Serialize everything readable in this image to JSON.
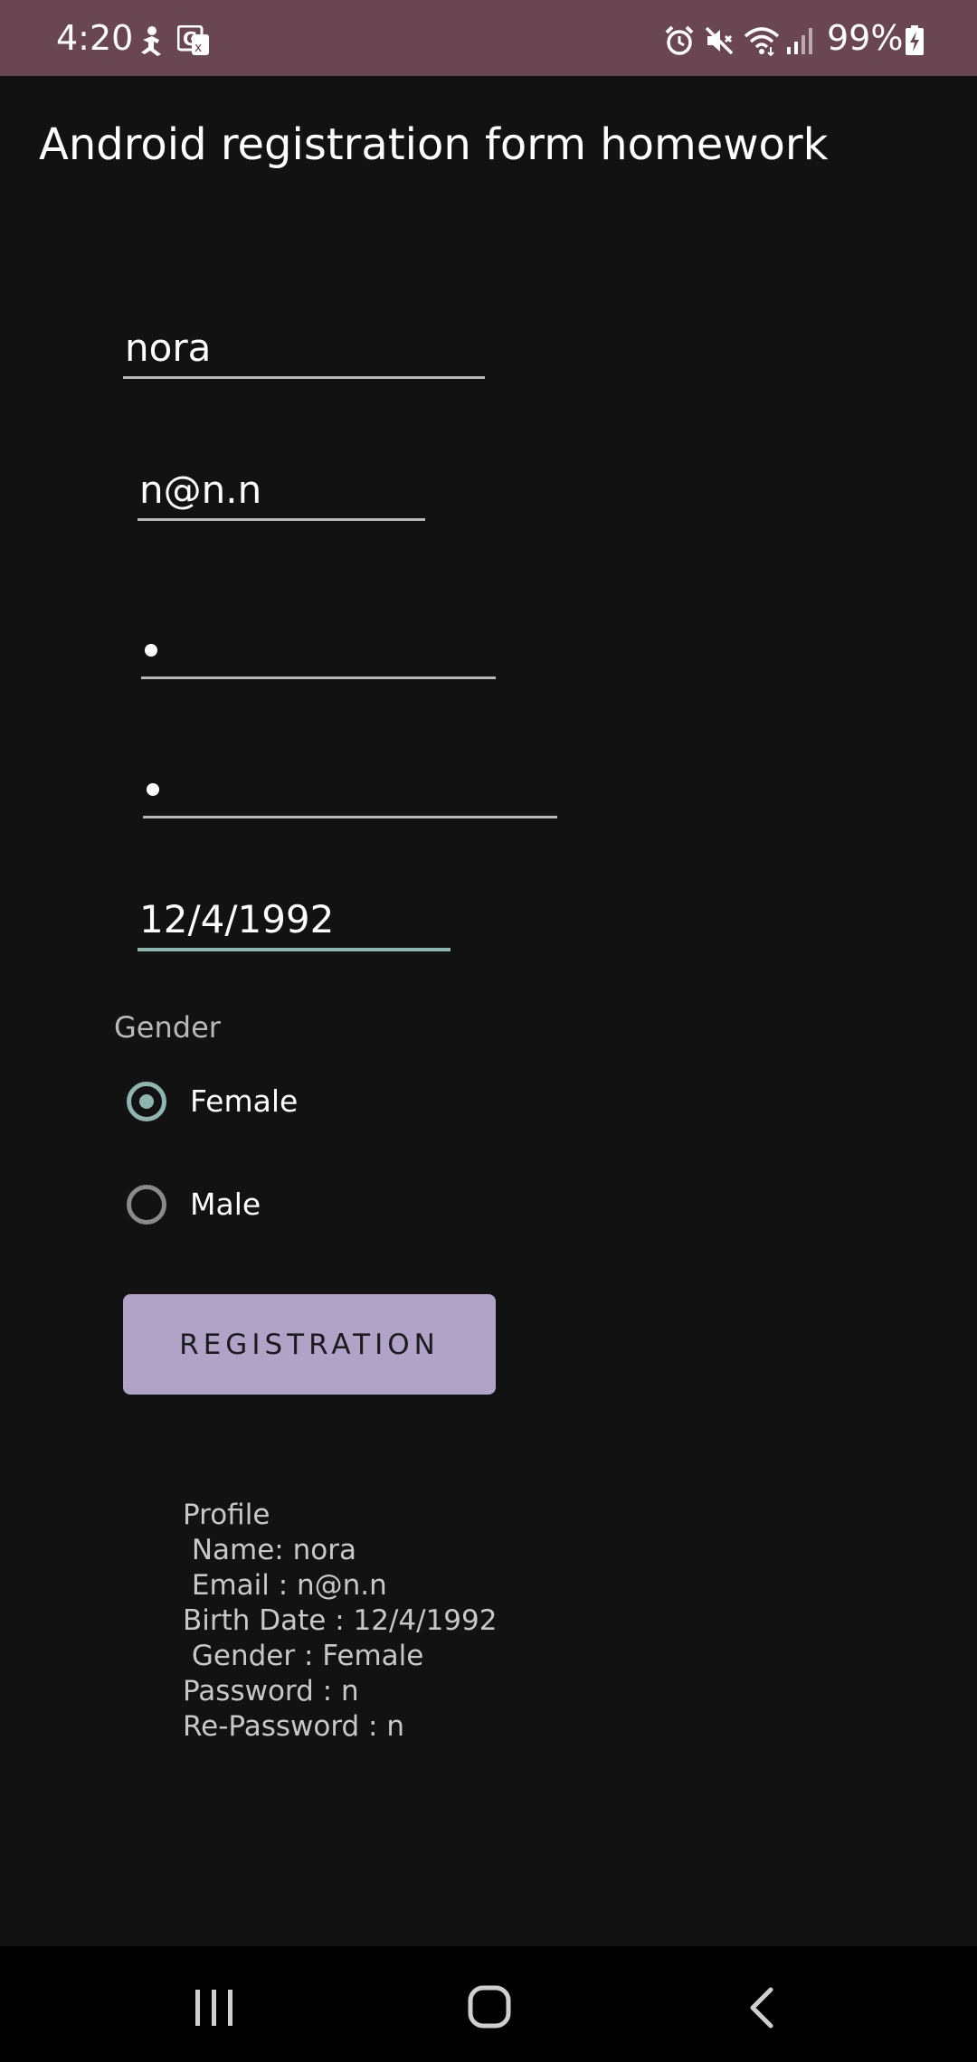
{
  "status_bar": {
    "time": "4:20",
    "battery": "99%",
    "background": "#6a4552",
    "icons": [
      "accessibility-icon",
      "translate-icon",
      "alarm-icon",
      "mute-icon",
      "wifi-icon",
      "signal-icon",
      "battery-charging-icon"
    ]
  },
  "app": {
    "title": "Android registration form homework"
  },
  "form": {
    "name_value": "nora",
    "email_value": "n@n.n",
    "password_value": "•",
    "repassword_value": "•",
    "birthdate_value": "12/4/1992",
    "gender_label": "Gender",
    "gender_options": [
      "Female",
      "Male"
    ],
    "selected_gender": "Female",
    "button_label": "REGISTRATION",
    "accent_color": "#8fb5b1",
    "button_color": "#b1a3c8"
  },
  "profile": {
    "heading": "Profile",
    "lines": [
      " Name: nora",
      " Email : n@n.n",
      "Birth Date : 12/4/1992",
      " Gender : Female",
      "Password : n",
      "Re-Password : n"
    ]
  },
  "nav_bar": {
    "icons": [
      "recent-apps-icon",
      "home-icon",
      "back-icon"
    ]
  }
}
